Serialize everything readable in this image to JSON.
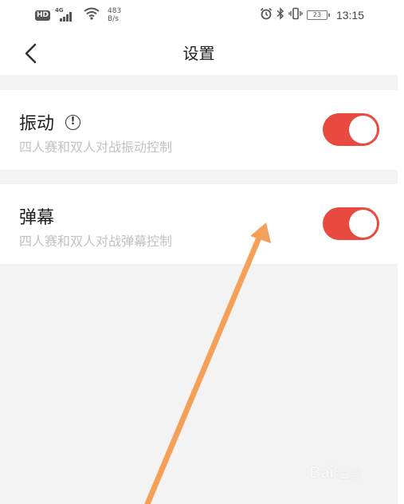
{
  "status_bar": {
    "hd": "HD",
    "network_gen": "4G",
    "speed_value": "483",
    "speed_unit": "B/s",
    "battery": "23",
    "time": "13:15",
    "icons": [
      "signal-icon",
      "wifi-icon",
      "alarm-icon",
      "bluetooth-icon",
      "vibrate-icon",
      "battery-icon"
    ]
  },
  "header": {
    "title": "设置",
    "back_icon": "chevron-left-icon"
  },
  "settings": [
    {
      "label": "振动",
      "description": "四人赛和双人对战振动控制",
      "has_info": true,
      "info_glyph": "!",
      "enabled": true
    },
    {
      "label": "弹幕",
      "description": "四人赛和双人对战弹幕控制",
      "has_info": false,
      "enabled": true
    }
  ],
  "colors": {
    "toggle_on": "#e84a3f",
    "annotation_arrow": "#f5a058",
    "background": "#f3f3f3"
  },
  "watermark": {
    "brand": "Bai",
    "suffix": "经验"
  }
}
